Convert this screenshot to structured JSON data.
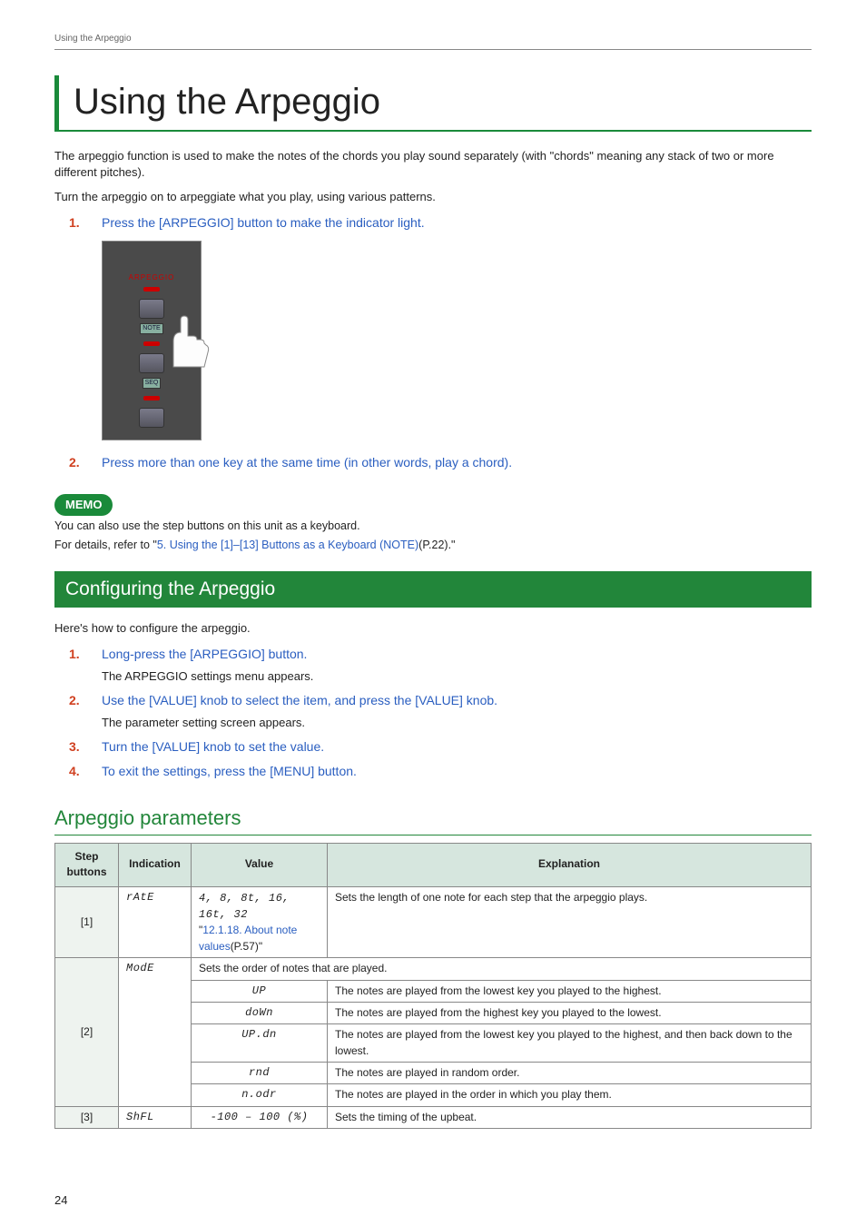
{
  "runningHead": "Using the Arpeggio",
  "pageTitle": "Using the Arpeggio",
  "intro1": "The arpeggio function is used to make the notes of the chords you play sound separately (with \"chords\" meaning any stack of two or more different pitches).",
  "intro2": "Turn the arpeggio on to arpeggiate what you play, using various patterns.",
  "steps1": [
    {
      "num": "1.",
      "text": "Press the [ARPEGGIO] button to make the indicator light."
    },
    {
      "num": "2.",
      "text": "Press more than one key at the same time (in other words, play a chord)."
    }
  ],
  "panel": {
    "arp": "ARPEGGIO",
    "note": "NOTE",
    "seq": "SEQ"
  },
  "memo": {
    "badge": "MEMO",
    "line1": "You can also use the step buttons on this unit as a keyboard.",
    "line2a": "For details, refer to \"",
    "link": "5. Using the [1]–[13] Buttons as a Keyboard (NOTE)",
    "line2b": "(P.22).\""
  },
  "sectionBar": "Configuring the Arpeggio",
  "confIntro": "Here's how to configure the arpeggio.",
  "steps2": [
    {
      "num": "1.",
      "text": "Long-press the [ARPEGGIO] button.",
      "sub": "The ARPEGGIO settings menu appears."
    },
    {
      "num": "2.",
      "text": "Use the [VALUE] knob to select the item, and press the [VALUE] knob.",
      "sub": "The parameter setting screen appears."
    },
    {
      "num": "3.",
      "text": "Turn the [VALUE] knob to set the value."
    },
    {
      "num": "4.",
      "text": "To exit the settings, press the [MENU] button."
    }
  ],
  "subhead": "Arpeggio parameters",
  "table": {
    "headers": {
      "step": "Step buttons",
      "ind": "Indication",
      "val": "Value",
      "exp": "Explanation"
    },
    "r1": {
      "step": "[1]",
      "ind": "rAtE",
      "val1": "4, 8, 8t, 16, 16t, 32",
      "val2a": "\"",
      "val2link": "12.1.18. About note values",
      "val2b": "(P.57)\"",
      "exp": "Sets the length of one note for each step that the arpeggio plays."
    },
    "r2": {
      "step": "[2]",
      "ind": "ModE",
      "span": "Sets the order of notes that are played.",
      "rows": [
        {
          "val": "UP",
          "exp": "The notes are played from the lowest key you played to the highest."
        },
        {
          "val": "doWn",
          "exp": "The notes are played from the highest key you played to the lowest."
        },
        {
          "val": "UP.dn",
          "exp": "The notes are played from the lowest key you played to the highest, and then back down to the lowest."
        },
        {
          "val": "rnd",
          "exp": "The notes are played in random order."
        },
        {
          "val": "n.odr",
          "exp": "The notes are played in the order in which you play them."
        }
      ]
    },
    "r3": {
      "step": "[3]",
      "ind": "ShFL",
      "val": "-100 – 100 (%)",
      "exp": "Sets the timing of the upbeat."
    }
  },
  "pageNum": "24"
}
